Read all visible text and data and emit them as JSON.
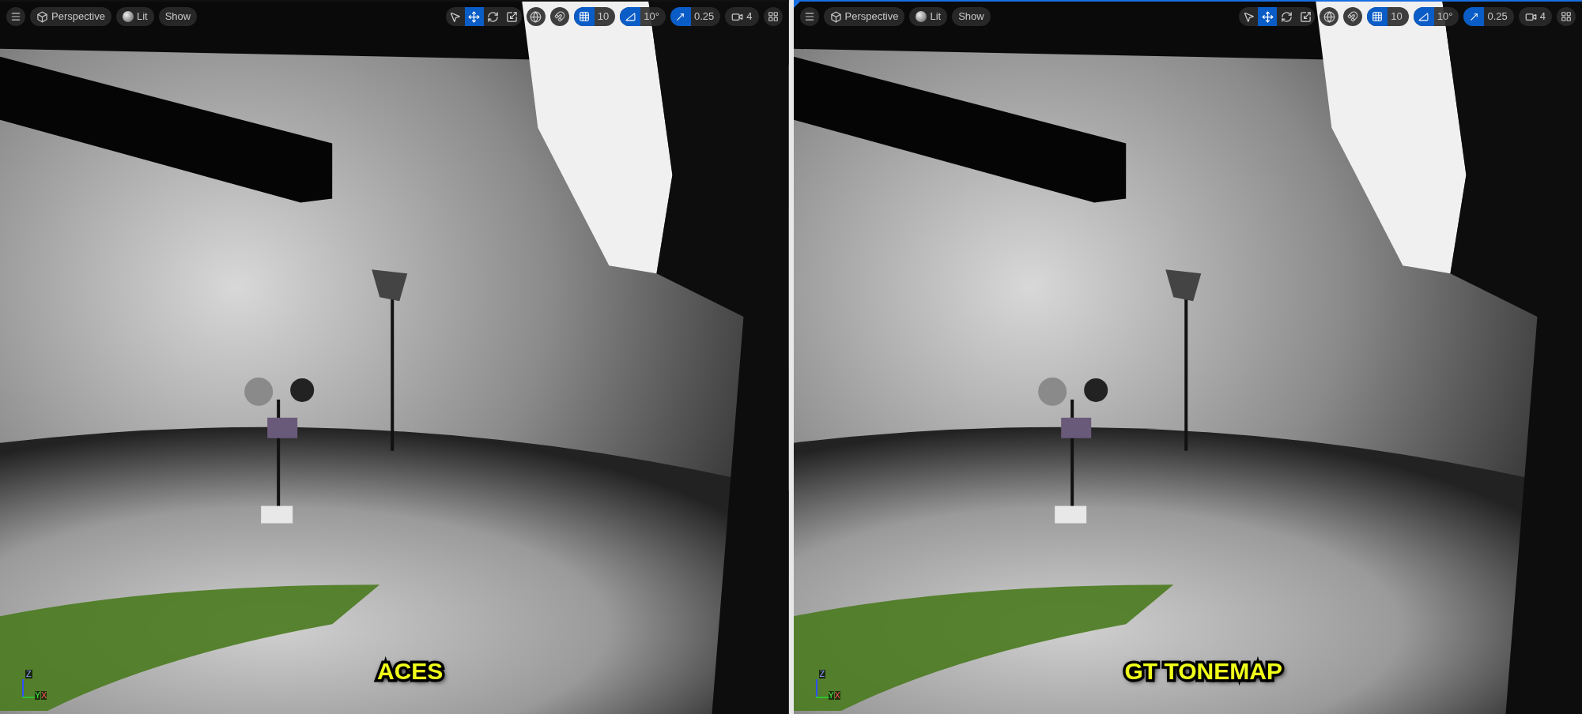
{
  "viewports": [
    {
      "selected": false,
      "toolbar": {
        "view_mode": "Perspective",
        "lighting": "Lit",
        "show": "Show",
        "transform_tools": [
          {
            "kind": "select",
            "selected": false
          },
          {
            "kind": "move",
            "selected": true
          },
          {
            "kind": "rotate",
            "selected": false
          },
          {
            "kind": "scale",
            "selected": false
          }
        ],
        "grid_snap": {
          "on": true,
          "value": "10"
        },
        "rotation_snap": {
          "on": true,
          "value": "10°"
        },
        "scale_snap": {
          "on": true,
          "value": "0.25"
        },
        "camera_speed": "4"
      },
      "axes": {
        "z": "Z",
        "y": "Y",
        "x": "X"
      },
      "caption": "ACES"
    },
    {
      "selected": true,
      "toolbar": {
        "view_mode": "Perspective",
        "lighting": "Lit",
        "show": "Show",
        "transform_tools": [
          {
            "kind": "select",
            "selected": false
          },
          {
            "kind": "move",
            "selected": true
          },
          {
            "kind": "rotate",
            "selected": false
          },
          {
            "kind": "scale",
            "selected": false
          }
        ],
        "grid_snap": {
          "on": true,
          "value": "10"
        },
        "rotation_snap": {
          "on": true,
          "value": "10°"
        },
        "scale_snap": {
          "on": true,
          "value": "0.25"
        },
        "camera_speed": "4"
      },
      "axes": {
        "z": "Z",
        "y": "Y",
        "x": "X"
      },
      "caption": "GT TONEMAP"
    }
  ]
}
